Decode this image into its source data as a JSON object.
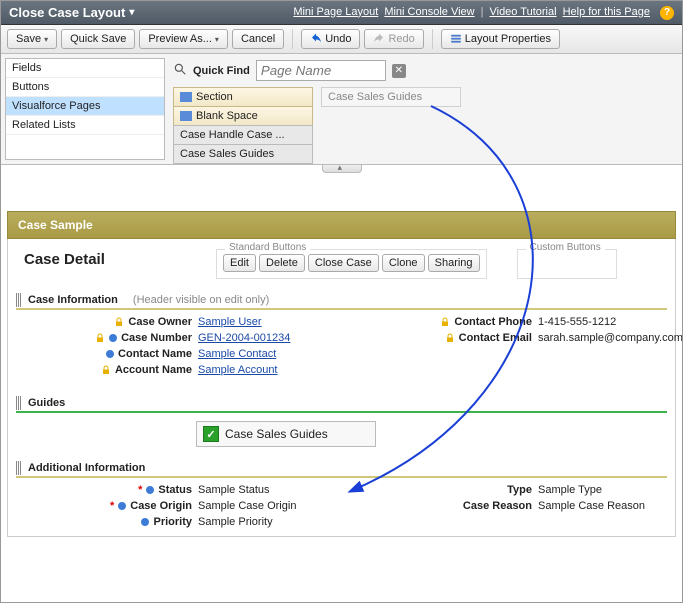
{
  "header": {
    "title": "Close Case Layout",
    "links": {
      "mini_page": "Mini Page Layout",
      "mini_console": "Mini Console View",
      "video": "Video Tutorial",
      "help": "Help for this Page"
    }
  },
  "toolbar": {
    "save": "Save",
    "quick_save": "Quick Save",
    "preview_as": "Preview As...",
    "cancel": "Cancel",
    "undo": "Undo",
    "redo": "Redo",
    "layout_props": "Layout Properties"
  },
  "palette": {
    "sidebar": [
      "Fields",
      "Buttons",
      "Visualforce Pages",
      "Related Lists"
    ],
    "selected_index": 2,
    "quick_find_label": "Quick Find",
    "quick_find_placeholder": "Page Name",
    "items": [
      "Section",
      "Blank Space",
      "Case Handle Case ...",
      "Case Sales Guides"
    ],
    "drop_hint": "Case Sales Guides"
  },
  "sample_bar": "Case Sample",
  "detail": {
    "title": "Case Detail",
    "std_legend": "Standard Buttons",
    "custom_legend": "Custom Buttons",
    "buttons": [
      "Edit",
      "Delete",
      "Close Case",
      "Clone",
      "Sharing"
    ]
  },
  "sections": {
    "info": {
      "title": "Case Information",
      "sub": "(Header visible on edit only)",
      "left": [
        {
          "label": "Case Owner",
          "value": "Sample User",
          "link": true,
          "lock": true
        },
        {
          "label": "Case Number",
          "value": "GEN-2004-001234",
          "link": true,
          "lock": true,
          "dot": true
        },
        {
          "label": "Contact Name",
          "value": "Sample Contact",
          "link": true,
          "dot": true
        },
        {
          "label": "Account Name",
          "value": "Sample Account",
          "link": true,
          "lock": true
        }
      ],
      "right": [
        {
          "label": "Contact Phone",
          "value": "1-415-555-1212",
          "lock": true
        },
        {
          "label": "Contact Email",
          "value": "sarah.sample@company.com",
          "lock": true
        }
      ]
    },
    "guides": {
      "title": "Guides",
      "dropped": "Case Sales Guides"
    },
    "additional": {
      "title": "Additional Information",
      "left": [
        {
          "label": "Status",
          "value": "Sample Status",
          "dot": true,
          "req": true
        },
        {
          "label": "Case Origin",
          "value": "Sample Case Origin",
          "dot": true,
          "req": true
        },
        {
          "label": "Priority",
          "value": "Sample Priority",
          "dot": true
        }
      ],
      "right": [
        {
          "label": "Type",
          "value": "Sample Type"
        },
        {
          "label": "Case Reason",
          "value": "Sample Case Reason"
        }
      ]
    }
  }
}
